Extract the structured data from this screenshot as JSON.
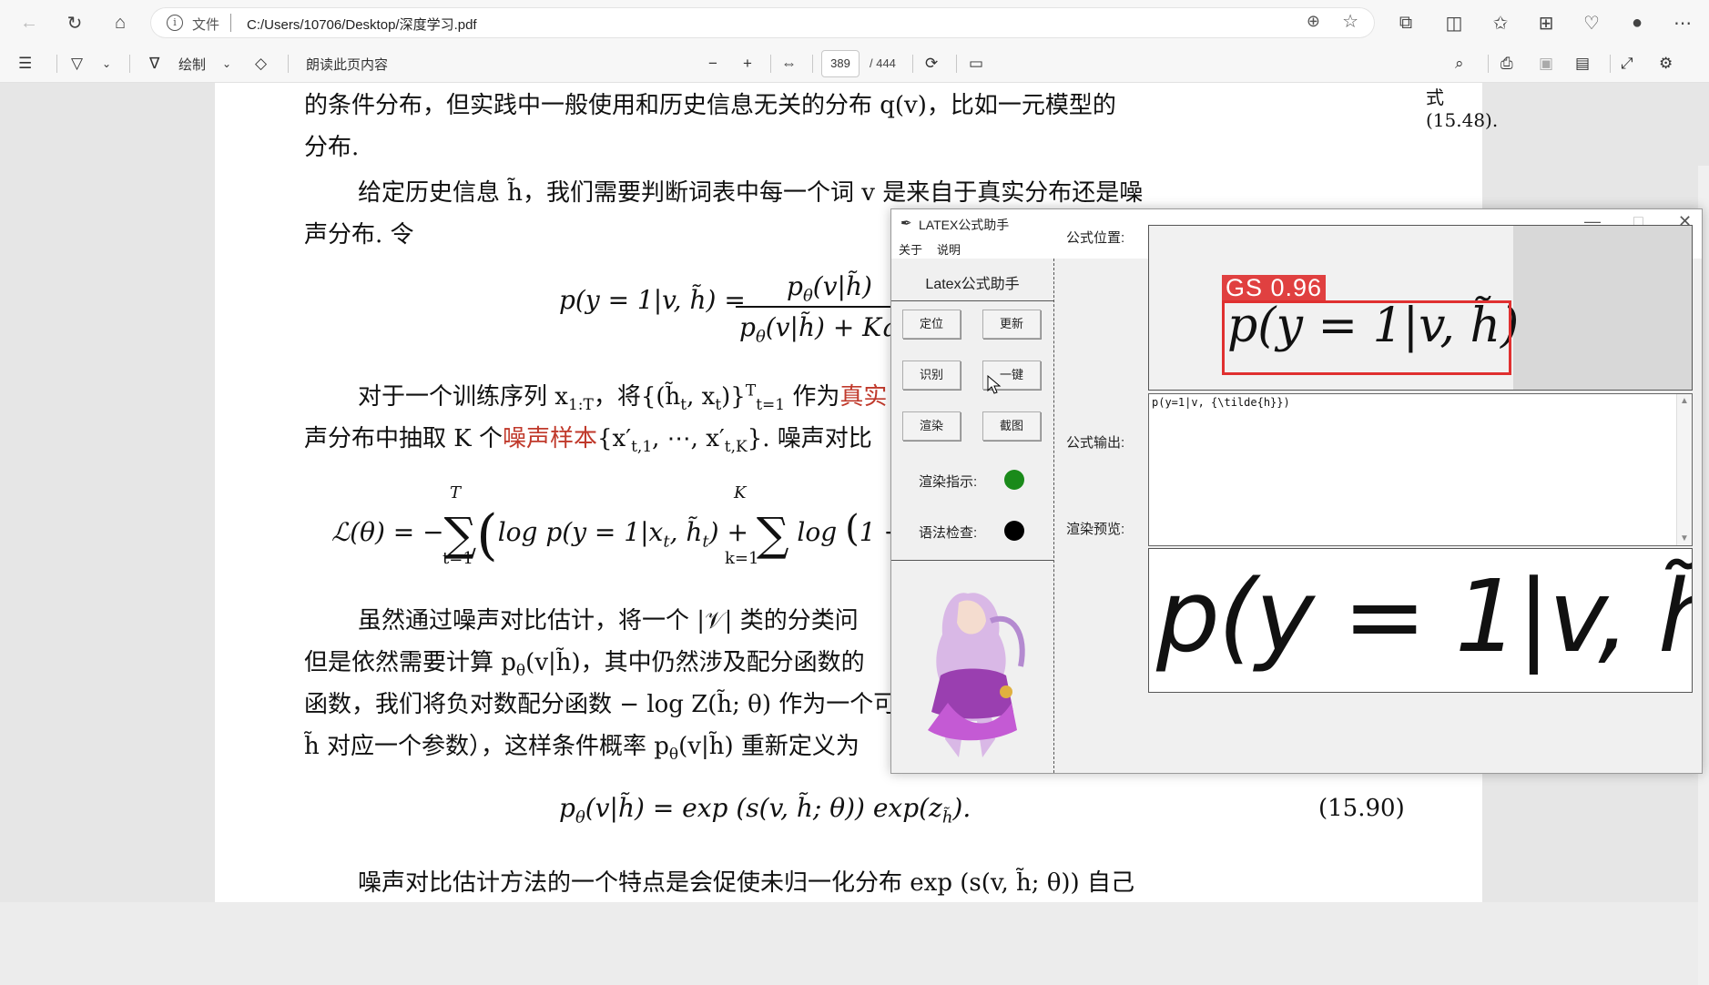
{
  "browser": {
    "protocol_label": "文件",
    "url": "C:/Users/10706/Desktop/深度学习.pdf"
  },
  "pdf_toolbar": {
    "draw_label": "绘制",
    "read_aloud_label": "朗读此页内容",
    "current_page": "389",
    "total_pages": "/ 444"
  },
  "document": {
    "side_ref": "式(15.48).",
    "line1": "的条件分布，但实践中一般使用和历史信息无关的分布 q(v)，比如一元模型的",
    "line2": "分布.",
    "line3": "给定历史信息 h̃，我们需要判断词表中每一个词 v 是来自于真实分布还是噪",
    "line4": "声分布. 令",
    "eq1_lhs": "p(y = 1|v, h̃) =",
    "eq1_num": "p",
    "eq1_den": "p",
    "line5_a": "对于一个训练序列 x",
    "line5_b": "，将{(h̃",
    "line5_c": " 作为",
    "line5_red": "真实",
    "line6_a": "声分布中抽取 K 个",
    "line6_red": "噪声样本",
    "line6_b": "{x′",
    "line6_c": "}. 噪声对比",
    "eq2": "ℒ(θ) = −",
    "line7": "虽然通过噪声对比估计，将一个 |𝒱| 类的分类问",
    "line8": "但是依然需要计算 p",
    "line9": "函数，我们将负对数配分函数 − log Z(h̃; θ) 作为一个可",
    "line10": "h̃ 对应一个参数），这样条件概率 p",
    "eq3": "p",
    "eq3_num": "(15.90)",
    "line11": "噪声对比估计方法的一个特点是会促使未归一化分布 exp (s(v, h̃; θ)) 自己"
  },
  "app": {
    "title": "LATEX公式助手",
    "menu_about": "关于",
    "menu_help": "说明",
    "heading": "Latex公式助手",
    "btn_locate": "定位",
    "btn_update": "更新",
    "btn_recognize": "识别",
    "btn_onekey": "一键",
    "btn_render": "渲染",
    "btn_screenshot": "截图",
    "render_indicator_label": "渲染指示:",
    "syntax_check_label": "语法检查:",
    "render_indicator_color": "#1a8a1a",
    "syntax_check_color": "#000000",
    "pos_label": "公式位置:",
    "out_label": "公式输出:",
    "preview_label": "渲染预览:",
    "detection_label": "GS 0.96",
    "formula_output": "p(y=1|v, {\\tilde{h}})",
    "detected_formula": "p(y = 1|v, h̃)",
    "preview_formula": "p(y = 1|v, h̃)"
  }
}
